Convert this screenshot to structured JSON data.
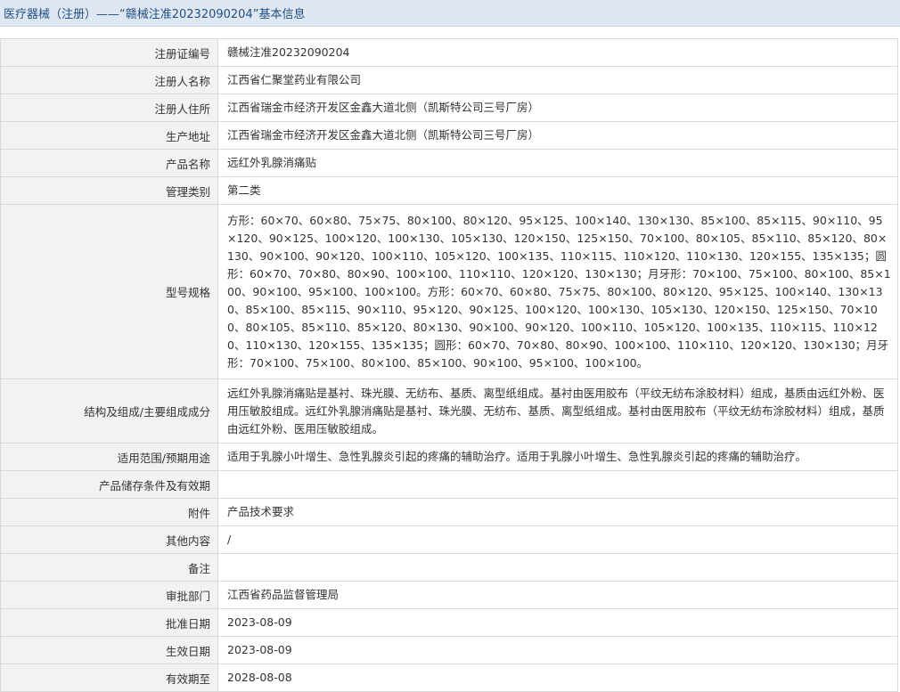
{
  "page": {
    "title": "医疗器械（注册）——“赣械注准20232090204”基本信息"
  },
  "rows": [
    {
      "label": "注册证编号",
      "value": "赣械注准20232090204"
    },
    {
      "label": "注册人名称",
      "value": "江西省仁聚堂药业有限公司"
    },
    {
      "label": "注册人住所",
      "value": "江西省瑞金市经济开发区金鑫大道北侧（凯斯特公司三号厂房）"
    },
    {
      "label": "生产地址",
      "value": "江西省瑞金市经济开发区金鑫大道北侧（凯斯特公司三号厂房）"
    },
    {
      "label": "产品名称",
      "value": "远红外乳腺消痛贴"
    },
    {
      "label": "管理类别",
      "value": "第二类"
    },
    {
      "label": "型号规格",
      "value": "方形：60×70、60×80、75×75、80×100、80×120、95×125、100×140、130×130、85×100、85×115、90×110、95×120、90×125、100×120、100×130、105×130、120×150、125×150、70×100、80×105、85×110、85×120、80×130、90×100、90×120、100×110、105×120、100×135、110×115、110×120、110×130、120×155、135×135；圆形：60×70、70×80、80×90、100×100、110×110、120×120、130×130；月牙形：70×100、75×100、80×100、85×100、90×100、95×100、100×100。方形：60×70、60×80、75×75、80×100、80×120、95×125、100×140、130×130、85×100、85×115、90×110、95×120、90×125、100×120、100×130、105×130、120×150、125×150、70×100、80×105、85×110、85×120、80×130、90×100、90×120、100×110、105×120、100×135、110×115、110×120、110×130、120×155、135×135；圆形：60×70、70×80、80×90、100×100、110×110、120×120、130×130；月牙形：70×100、75×100、80×100、85×100、90×100、95×100、100×100。"
    },
    {
      "label": "结构及组成/主要组成成分",
      "value": "远红外乳腺消痛贴是基衬、珠光膜、无纺布、基质、离型纸组成。基衬由医用胶布（平纹无纺布涂胶材料）组成，基质由远红外粉、医用压敏胶组成。远红外乳腺消痛贴是基衬、珠光膜、无纺布、基质、离型纸组成。基衬由医用胶布（平纹无纺布涂胶材料）组成，基质由远红外粉、医用压敏胶组成。"
    },
    {
      "label": "适用范围/预期用途",
      "value": "适用于乳腺小叶增生、急性乳腺炎引起的疼痛的辅助治疗。适用于乳腺小叶增生、急性乳腺炎引起的疼痛的辅助治疗。"
    },
    {
      "label": "产品储存条件及有效期",
      "value": ""
    },
    {
      "label": "附件",
      "value": "产品技术要求"
    },
    {
      "label": "其他内容",
      "value": "/"
    },
    {
      "label": "备注",
      "value": ""
    },
    {
      "label": "审批部门",
      "value": "江西省药品监督管理局"
    },
    {
      "label": "批准日期",
      "value": "2023-08-09"
    },
    {
      "label": "生效日期",
      "value": "2023-08-09"
    },
    {
      "label": "有效期至",
      "value": "2028-08-08"
    }
  ]
}
